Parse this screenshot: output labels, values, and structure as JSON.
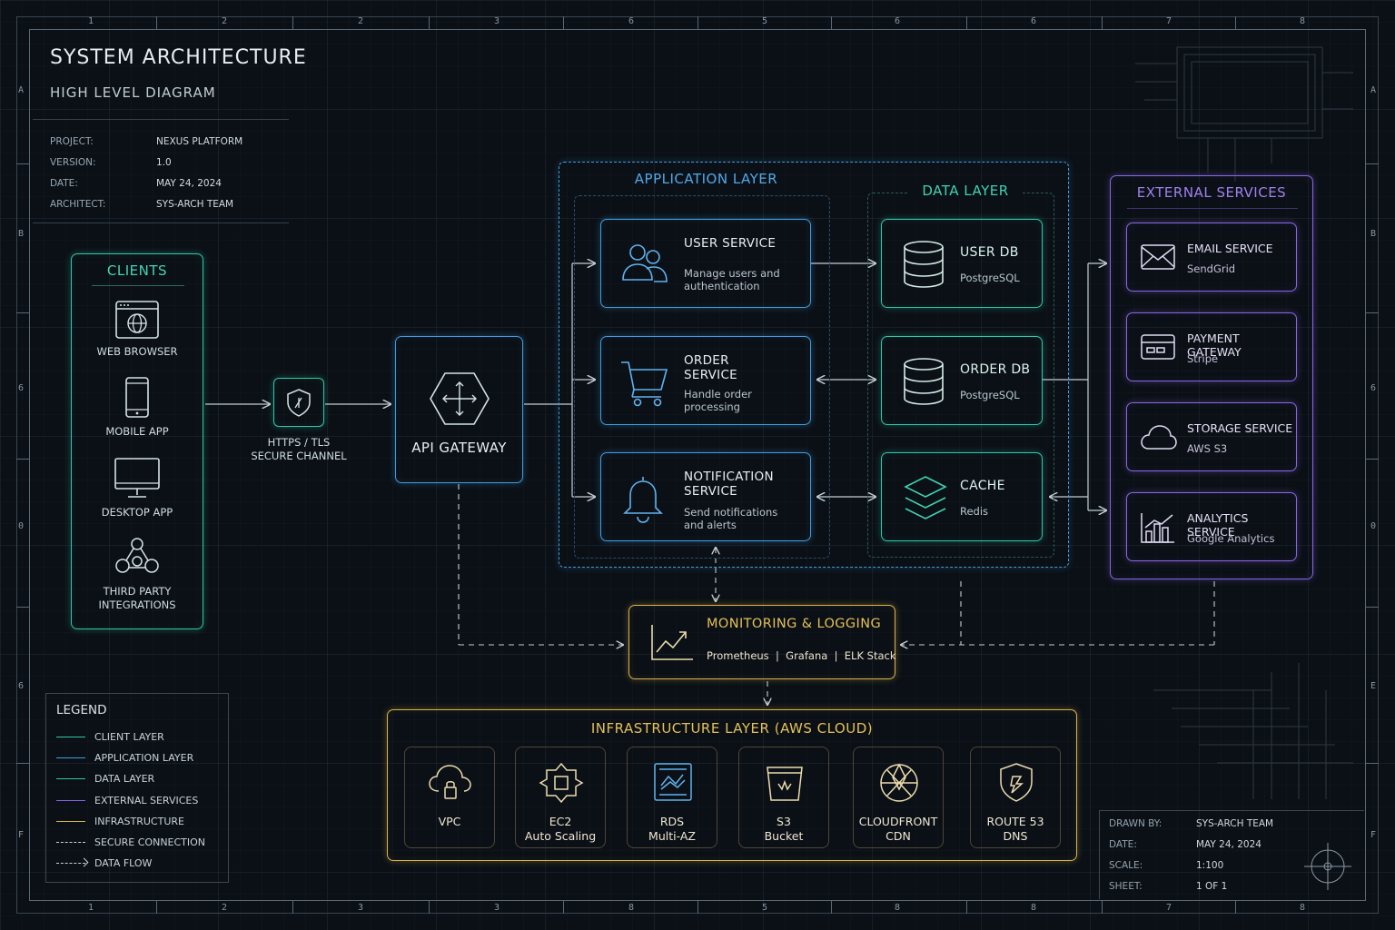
{
  "header": {
    "title": "SYSTEM ARCHITECTURE",
    "subtitle": "HIGH LEVEL DIAGRAM",
    "meta": [
      {
        "k": "PROJECT:",
        "v": "NEXUS PLATFORM"
      },
      {
        "k": "VERSION:",
        "v": "1.0"
      },
      {
        "k": "DATE:",
        "v": "MAY 24, 2024"
      },
      {
        "k": "ARCHITECT:",
        "v": "SYS-ARCH TEAM"
      }
    ]
  },
  "ruler": {
    "top": [
      "1",
      "2",
      "2",
      "3",
      "6",
      "5",
      "6",
      "6",
      "7",
      "8"
    ],
    "bottom": [
      "1",
      "2",
      "3",
      "3",
      "8",
      "5",
      "8",
      "8",
      "7",
      "8"
    ],
    "left": [
      "A",
      "B",
      "6",
      "0",
      "6",
      "F"
    ],
    "right": [
      "A",
      "B",
      "6",
      "0",
      "E",
      "F"
    ]
  },
  "clients": {
    "title": "CLIENTS",
    "items": [
      {
        "label": "WEB BROWSER",
        "icon": "globe-browser-icon"
      },
      {
        "label": "MOBILE APP",
        "icon": "mobile-phone-icon"
      },
      {
        "label": "DESKTOP APP",
        "icon": "desktop-monitor-icon"
      },
      {
        "label": "THIRD PARTY",
        "label2": "INTEGRATIONS",
        "icon": "network-nodes-icon"
      }
    ]
  },
  "secure_channel": {
    "line1": "HTTPS / TLS",
    "line2": "SECURE CHANNEL"
  },
  "gateway": {
    "label": "API GATEWAY"
  },
  "app_layer": {
    "title": "APPLICATION LAYER",
    "services": [
      {
        "name": "USER SERVICE",
        "name2": "",
        "desc1": "Manage users and",
        "desc2": "authentication"
      },
      {
        "name": "ORDER",
        "name2": "SERVICE",
        "desc1": "Handle order",
        "desc2": "processing"
      },
      {
        "name": "NOTIFICATION",
        "name2": "SERVICE",
        "desc1": "Send notifications",
        "desc2": "and alerts"
      }
    ]
  },
  "data_layer": {
    "title": "DATA LAYER",
    "stores": [
      {
        "name": "USER DB",
        "sub": "PostgreSQL"
      },
      {
        "name": "ORDER DB",
        "sub": "PostgreSQL"
      },
      {
        "name": "CACHE",
        "sub": "Redis"
      }
    ]
  },
  "external": {
    "title": "EXTERNAL SERVICES",
    "items": [
      {
        "name": "EMAIL SERVICE",
        "sub": "SendGrid"
      },
      {
        "name": "PAYMENT GATEWAY",
        "sub": "Stripe"
      },
      {
        "name": "STORAGE SERVICE",
        "sub": "AWS S3"
      },
      {
        "name": "ANALYTICS SERVICE",
        "sub": "Google Analytics"
      }
    ]
  },
  "monitoring": {
    "title": "MONITORING & LOGGING",
    "tools": "Prometheus  |  Grafana  |  ELK Stack"
  },
  "infra": {
    "title": "INFRASTRUCTURE LAYER (AWS CLOUD)",
    "items": [
      {
        "name": "VPC",
        "name2": ""
      },
      {
        "name": "EC2",
        "name2": "Auto Scaling"
      },
      {
        "name": "RDS",
        "name2": "Multi-AZ"
      },
      {
        "name": "S3",
        "name2": "Bucket"
      },
      {
        "name": "CLOUDFRONT",
        "name2": "CDN"
      },
      {
        "name": "ROUTE 53",
        "name2": "DNS"
      }
    ]
  },
  "legend": {
    "title": "LEGEND",
    "items": [
      {
        "label": "CLIENT LAYER",
        "color": "#2fc7a8",
        "style": "solid"
      },
      {
        "label": "APPLICATION LAYER",
        "color": "#3f9de0",
        "style": "solid"
      },
      {
        "label": "DATA LAYER",
        "color": "#2fc7a8",
        "style": "solid"
      },
      {
        "label": "EXTERNAL SERVICES",
        "color": "#8a66e6",
        "style": "solid"
      },
      {
        "label": "INFRASTRUCTURE",
        "color": "#d9b24a",
        "style": "solid"
      },
      {
        "label": "SECURE CONNECTION",
        "color": "#c8d2db",
        "style": "dashed"
      },
      {
        "label": "DATA FLOW",
        "color": "#c8d2db",
        "style": "dashed-arrow"
      }
    ]
  },
  "title_block": {
    "rows": [
      {
        "k": "DRAWN BY:",
        "v": "SYS-ARCH TEAM"
      },
      {
        "k": "DATE:",
        "v": "MAY 24, 2024"
      },
      {
        "k": "SCALE:",
        "v": "1:100"
      },
      {
        "k": "SHEET:",
        "v": "1 OF 1"
      }
    ]
  },
  "colors": {
    "background": "#0b1016",
    "client": "#2fc7a8",
    "application": "#3f9de0",
    "data": "#2fc7a8",
    "external": "#8a66e6",
    "infrastructure": "#d9b24a"
  }
}
